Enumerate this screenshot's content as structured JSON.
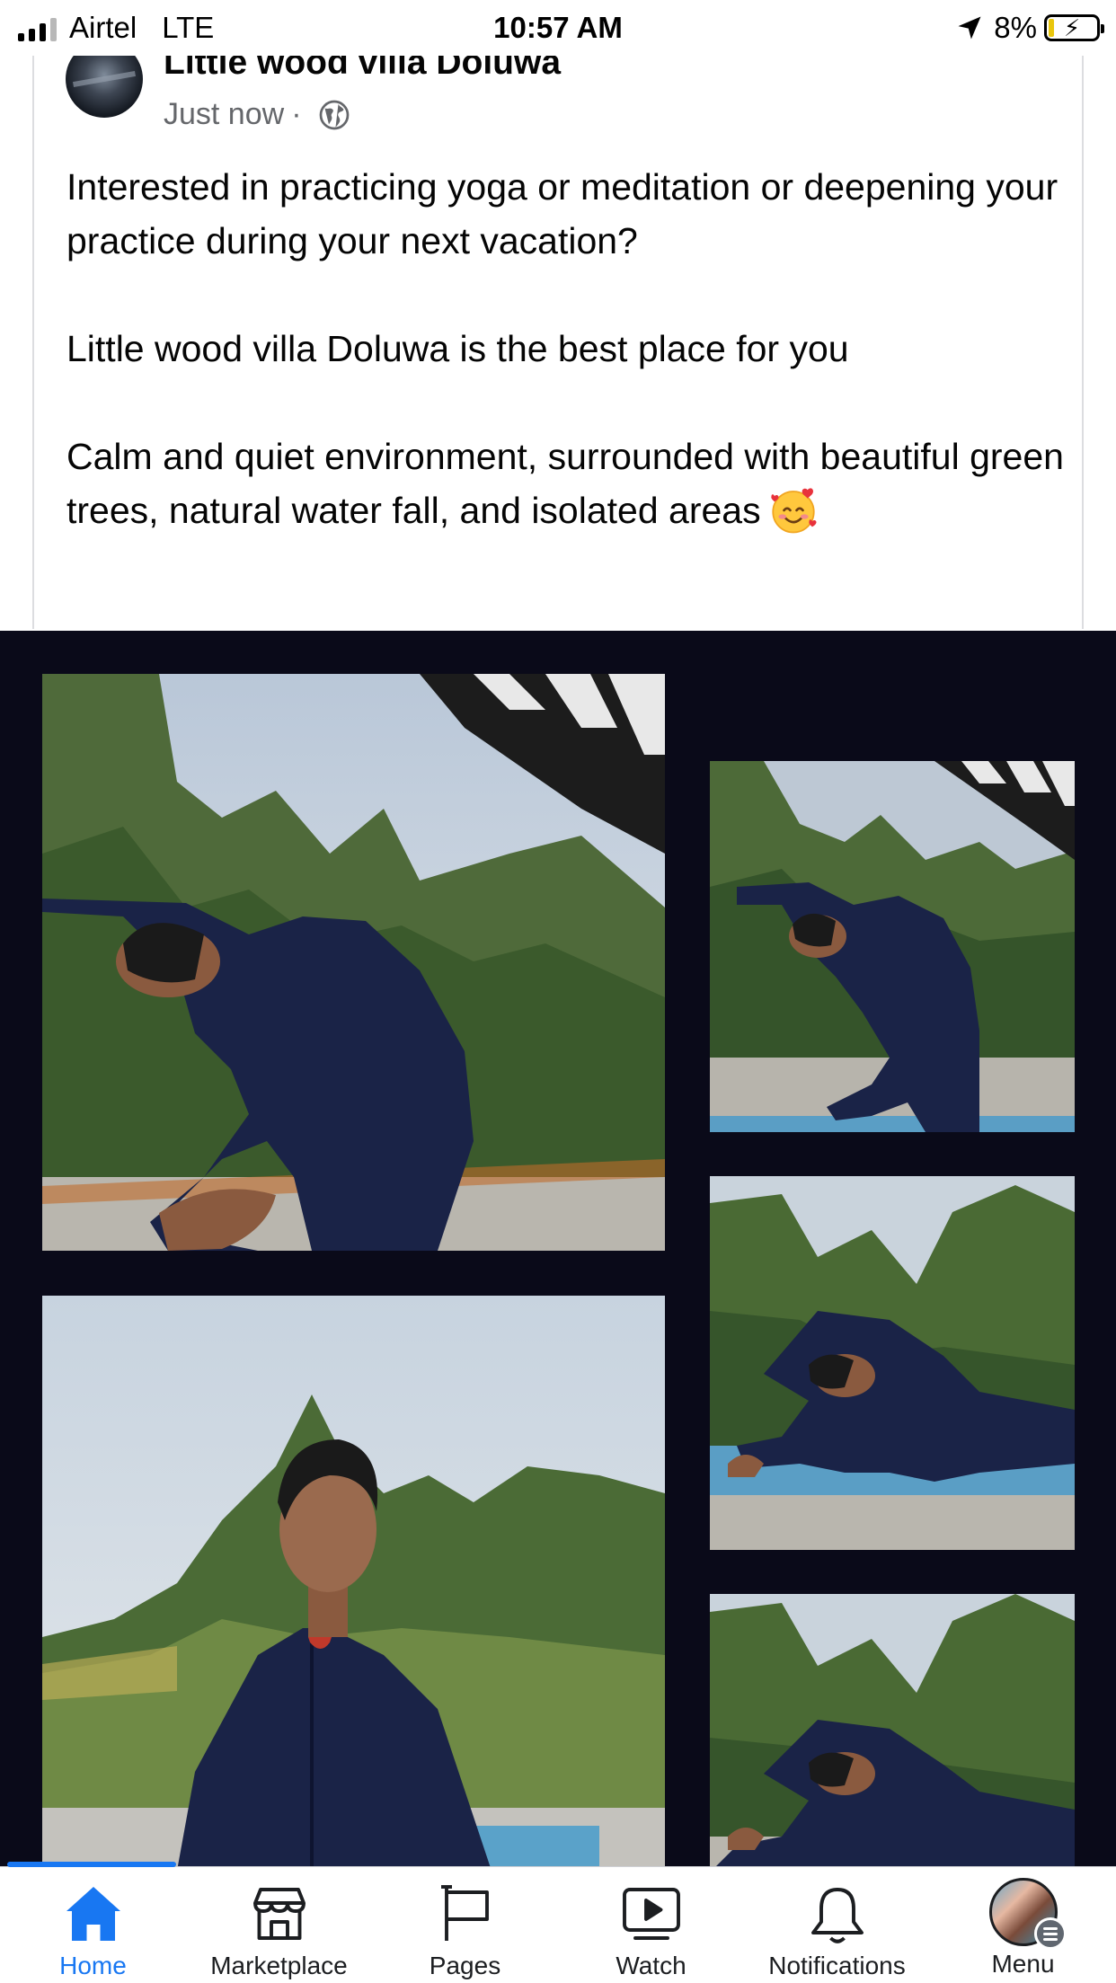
{
  "status_bar": {
    "carrier": "Airtel",
    "network": "LTE",
    "time": "10:57 AM",
    "battery": "8%"
  },
  "post": {
    "page_name": "Little wood villa Doluwa",
    "timestamp": "Just now",
    "separator": "·",
    "visibility_icon": "globe-icon",
    "paragraphs": [
      "Interested in practicing yoga or meditation or deepening your practice during your next vacation?",
      "Little wood villa Doluwa is the best place for you",
      "Calm and quiet environment, surrounded with beautiful green trees, natural water fall, and isolated areas"
    ],
    "emoji": "smiling-face-with-hearts",
    "photos": [
      {
        "subject": "woman in side-bend yoga pose on terrace",
        "icon": "photo"
      },
      {
        "subject": "woman in side-bend yoga pose on mat",
        "icon": "photo"
      },
      {
        "subject": "woman in seated side stretch on mat",
        "icon": "photo"
      },
      {
        "subject": "woman meditating with eyes closed",
        "icon": "photo"
      },
      {
        "subject": "woman in seated side stretch outdoors",
        "icon": "photo"
      }
    ]
  },
  "bottom_nav": {
    "items": [
      {
        "label": "Home",
        "icon": "home-icon",
        "active": true
      },
      {
        "label": "Marketplace",
        "icon": "marketplace-icon",
        "active": false
      },
      {
        "label": "Pages",
        "icon": "flag-icon",
        "active": false
      },
      {
        "label": "Watch",
        "icon": "video-icon",
        "active": false
      },
      {
        "label": "Notifications",
        "icon": "bell-icon",
        "active": false
      },
      {
        "label": "Menu",
        "icon": "profile-avatar",
        "active": false
      }
    ]
  },
  "colors": {
    "accent": "#1877f2",
    "text_primary": "#050505",
    "text_secondary": "#65676b",
    "collage_background": "#0a0a19"
  }
}
